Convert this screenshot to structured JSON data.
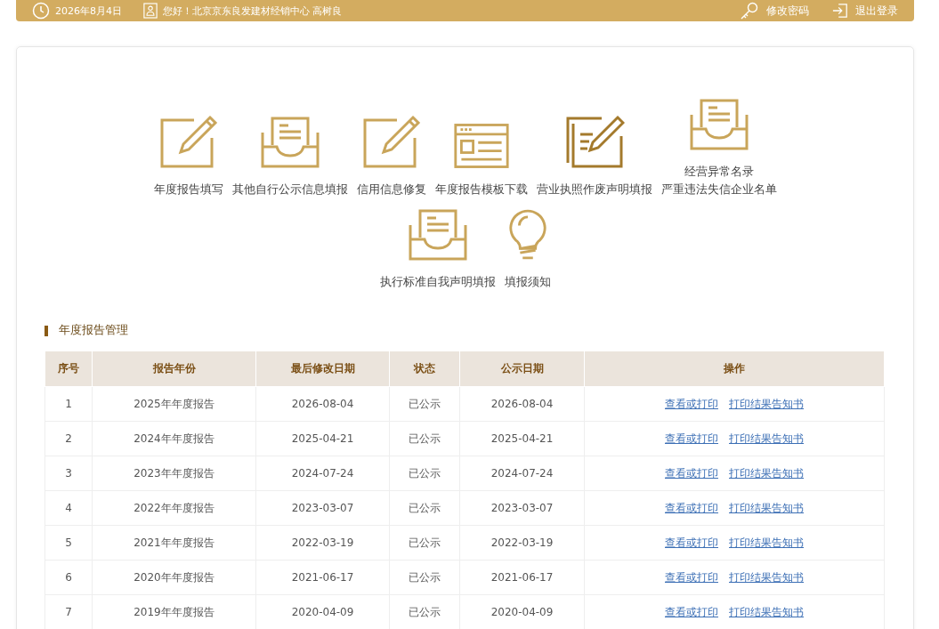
{
  "header": {
    "date": "2026年8月4日",
    "greeting": "您好！北京京东良发建材经销中心  高树良",
    "actions": [
      {
        "kind": "key",
        "label": "修改密码"
      },
      {
        "kind": "logout",
        "label": "退出登录"
      }
    ]
  },
  "shortcuts": [
    {
      "kind": "edit",
      "lines": [
        "年度报告填写"
      ]
    },
    {
      "kind": "tray",
      "lines": [
        "其他自行公示信息填报"
      ]
    },
    {
      "kind": "edit",
      "lines": [
        "信用信息修复"
      ]
    },
    {
      "kind": "window",
      "lines": [
        "年度报告模板下载"
      ]
    },
    {
      "kind": "document",
      "lines": [
        "营业执照作废声明填报"
      ]
    },
    {
      "kind": "tray",
      "lines": [
        "经营异常名录",
        "严重违法失信企业名单"
      ]
    },
    {
      "kind": "tray",
      "lines": [
        "执行标准自我声明填报"
      ]
    },
    {
      "kind": "bulb",
      "lines": [
        "填报须知"
      ]
    }
  ],
  "section_title": "年度报告管理",
  "table": {
    "columns": [
      "序号",
      "报告年份",
      "最后修改日期",
      "状态",
      "公示日期",
      "操作"
    ],
    "rows": [
      {
        "cells": [
          "1",
          "2025年年度报告",
          "2026-08-04",
          "已公示",
          "2026-08-04"
        ],
        "links": [
          "查看或打印",
          "打印结果告知书"
        ]
      },
      {
        "cells": [
          "2",
          "2024年年度报告",
          "2025-04-21",
          "已公示",
          "2025-04-21"
        ],
        "links": [
          "查看或打印",
          "打印结果告知书"
        ]
      },
      {
        "cells": [
          "3",
          "2023年年度报告",
          "2024-07-24",
          "已公示",
          "2024-07-24"
        ],
        "links": [
          "查看或打印",
          "打印结果告知书"
        ]
      },
      {
        "cells": [
          "4",
          "2022年年度报告",
          "2023-03-07",
          "已公示",
          "2023-03-07"
        ],
        "links": [
          "查看或打印",
          "打印结果告知书"
        ]
      },
      {
        "cells": [
          "5",
          "2021年年度报告",
          "2022-03-19",
          "已公示",
          "2022-03-19"
        ],
        "links": [
          "查看或打印",
          "打印结果告知书"
        ]
      },
      {
        "cells": [
          "6",
          "2020年年度报告",
          "2021-06-17",
          "已公示",
          "2021-06-17"
        ],
        "links": [
          "查看或打印",
          "打印结果告知书"
        ]
      },
      {
        "cells": [
          "7",
          "2019年年度报告",
          "2020-04-09",
          "已公示",
          "2020-04-09"
        ],
        "links": [
          "查看或打印",
          "打印结果告知书"
        ]
      }
    ]
  }
}
